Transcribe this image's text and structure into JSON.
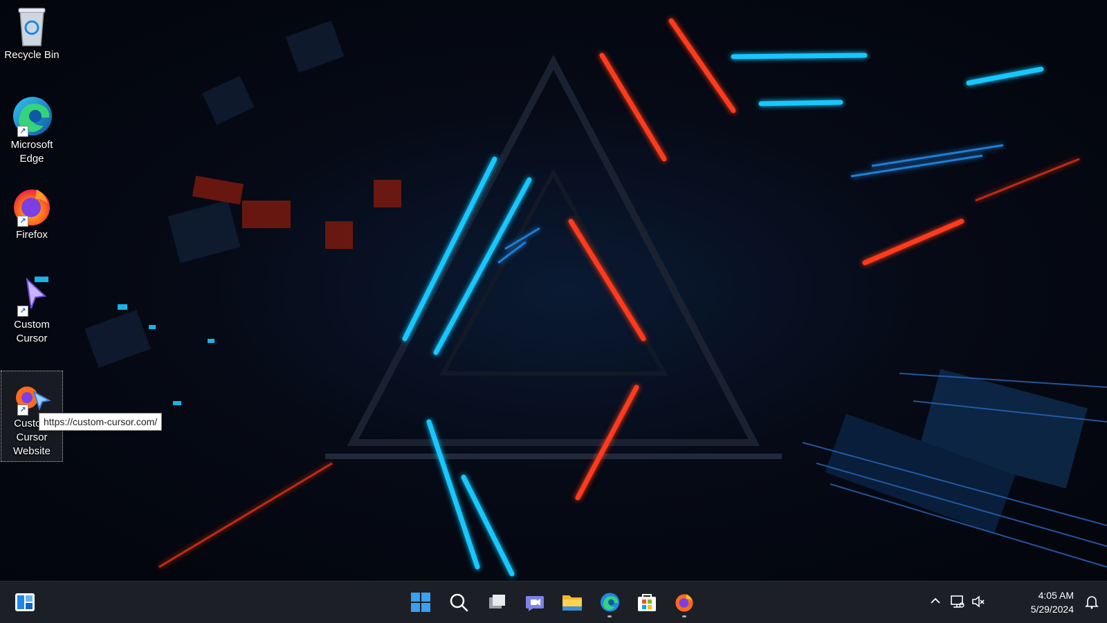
{
  "desktop": {
    "icons": [
      {
        "label": "Recycle Bin"
      },
      {
        "label": "Microsoft Edge"
      },
      {
        "label": "Firefox"
      },
      {
        "label": "Custom Cursor"
      },
      {
        "label": "Custom Cursor Website"
      }
    ],
    "tooltip": "https://custom-cursor.com/"
  },
  "taskbar": {
    "clock_time": "4:05 AM",
    "clock_date": "5/29/2024"
  },
  "colors": {
    "neon_blue": "#18c8ff",
    "neon_red": "#ff3a1a",
    "taskbar_bg": "#1c1f26"
  }
}
